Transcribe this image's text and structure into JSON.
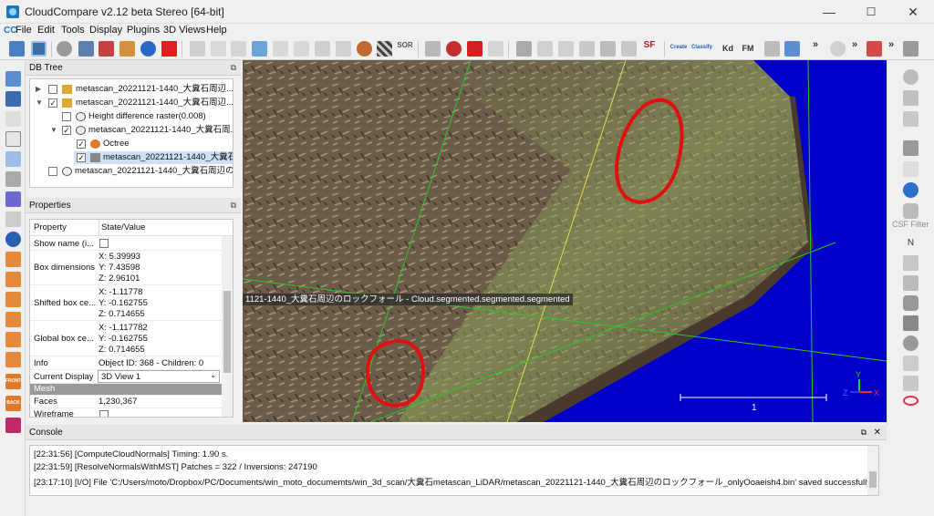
{
  "window": {
    "title": "CloudCompare v2.12 beta Stereo [64-bit]",
    "minimize_glyph": "—",
    "maximize_glyph": "☐",
    "close_glyph": "✕"
  },
  "menu": {
    "logo_glyph": "CC",
    "items": [
      "File",
      "Edit",
      "Tools",
      "Display",
      "Plugins",
      "3D Views",
      "Help"
    ]
  },
  "toolbar": {
    "sor_label": "SOR",
    "sf_label": "SF",
    "canupo_create_label": "Create",
    "canupo_classify_label": "Classify",
    "kd_label": "Kd",
    "fm_label": "FM",
    "more_glyph": "»"
  },
  "db_tree": {
    "title": "DB Tree",
    "float_glyph": "⧉",
    "rows": [
      {
        "label": "metascan_20221121-1440_大糞石周辺..."
      },
      {
        "label": "metascan_20221121-1440_大糞石周辺..."
      },
      {
        "label": "Height difference raster(0.008)"
      },
      {
        "label": "metascan_20221121-1440_大糞石周..."
      },
      {
        "label": "Octree"
      },
      {
        "label": "metascan_20221121-1440_大糞石..."
      },
      {
        "label": "metascan_20221121-1440_大糞石周辺の..."
      }
    ],
    "checked_glyph": "✓",
    "expanded_glyph": "▼",
    "collapsed_glyph": "▶"
  },
  "properties": {
    "title": "Properties",
    "float_glyph": "⧉",
    "col_property": "Property",
    "col_value": "State/Value",
    "rows": {
      "show_name": {
        "name": "Show name (i...",
        "value": ""
      },
      "box_dim": {
        "name": "Box dimensions",
        "x": "X: 5.39993",
        "y": "Y: 7.43598",
        "z": "Z: 2.96101"
      },
      "shifted_box": {
        "name": "Shifted box ce...",
        "x": "X: -1.11778",
        "y": "Y: -0.162755",
        "z": "Z: 0.714655"
      },
      "global_box": {
        "name": "Global box ce...",
        "x": "X: -1.117782",
        "y": "Y: -0.162755",
        "z": "Z: 0.714655"
      },
      "info": {
        "name": "Info",
        "value": "Object ID: 368 - Children: 0"
      },
      "current_display": {
        "name": "Current Display",
        "value": "3D View 1"
      },
      "mesh_section": {
        "name": "Mesh"
      },
      "faces": {
        "name": "Faces",
        "value": "1,230,367"
      },
      "wireframe": {
        "name": "Wireframe",
        "value": ""
      }
    }
  },
  "viewport": {
    "overlay_label": "1121-1440_大糞石周辺のロックフォール - Cloud.segmented.segmented.segmented",
    "scale_value": "1",
    "axis_labels": {
      "z": "Z",
      "y": "Y",
      "x": "X"
    },
    "colors": {
      "background": "#0000c8",
      "mesh_light": "#8a9a6a",
      "mesh_dark": "#5a4a3a",
      "annotation": "#e01010"
    }
  },
  "rightbar": {
    "csf_label": "CSF Filter",
    "n_label": "N"
  },
  "leftbar": {
    "front_label": "FRONT",
    "back_label": "BACK"
  },
  "console": {
    "title": "Console",
    "float_glyph": "⧉",
    "close_glyph": "✕",
    "lines": [
      "[22:31:56] [ComputeCloudNormals] Timing: 1.90 s.",
      "[22:31:59] [ResolveNormalsWithMST] Patches = 322 / Inversions: 247190",
      "[23:17:10] [I/O] File 'C:/Users/moto/Dropbox/PC/Documents/win_moto_documemts/win_3d_scan/大糞石metascan_LiDAR/metascan_20221121-1440_大糞石周辺のロックフォール_onlyOoaeish4.bin' saved successfully"
    ]
  }
}
